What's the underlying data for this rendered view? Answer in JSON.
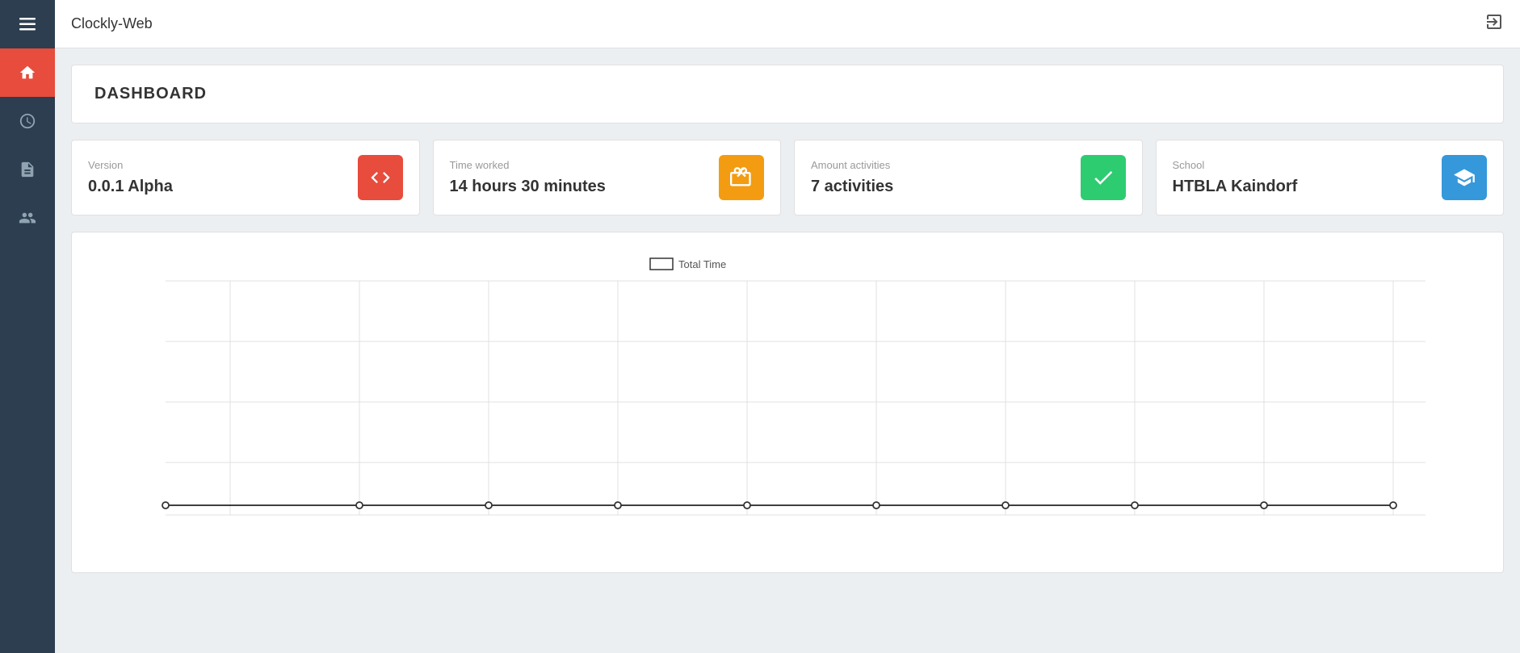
{
  "app": {
    "title": "Clockly-Web"
  },
  "sidebar": {
    "items": [
      {
        "name": "home",
        "label": "Home",
        "active": true
      },
      {
        "name": "timer",
        "label": "Timer",
        "active": false
      },
      {
        "name": "reports",
        "label": "Reports",
        "active": false
      },
      {
        "name": "users",
        "label": "Users",
        "active": false
      }
    ]
  },
  "dashboard": {
    "title": "DASHBOARD"
  },
  "stats": [
    {
      "label": "Version",
      "value": "0.0.1 Alpha",
      "icon": "code-icon",
      "icon_color": "red"
    },
    {
      "label": "Time worked",
      "value": "14 hours 30 minutes",
      "icon": "clock-icon",
      "icon_color": "orange"
    },
    {
      "label": "Amount activities",
      "value": "7 activities",
      "icon": "check-icon",
      "icon_color": "green"
    },
    {
      "label": "School",
      "value": "HTBLA Kaindorf",
      "icon": "school-icon",
      "icon_color": "blue"
    }
  ],
  "chart": {
    "legend_label": "Total Time"
  }
}
